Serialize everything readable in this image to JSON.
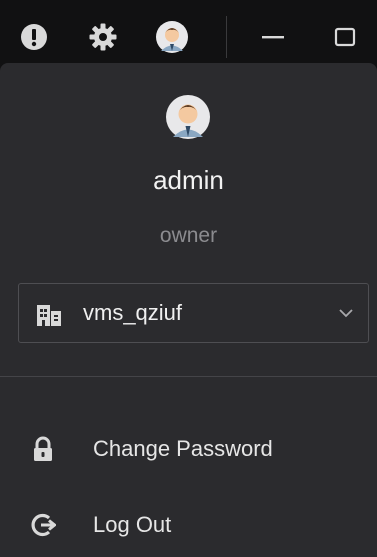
{
  "titlebar": {
    "icons": [
      "alert-icon",
      "gear-icon",
      "avatar-icon",
      "minimize-icon",
      "maximize-icon"
    ]
  },
  "user": {
    "name": "admin",
    "role": "owner"
  },
  "tenant": {
    "selected": "vms_qziuf"
  },
  "menu": {
    "change_password": "Change Password",
    "log_out": "Log Out"
  },
  "colors": {
    "background": "#2b2b2e",
    "titlebar": "#111112",
    "text": "#f0f0f0",
    "muted_text": "#8b8b8f"
  }
}
